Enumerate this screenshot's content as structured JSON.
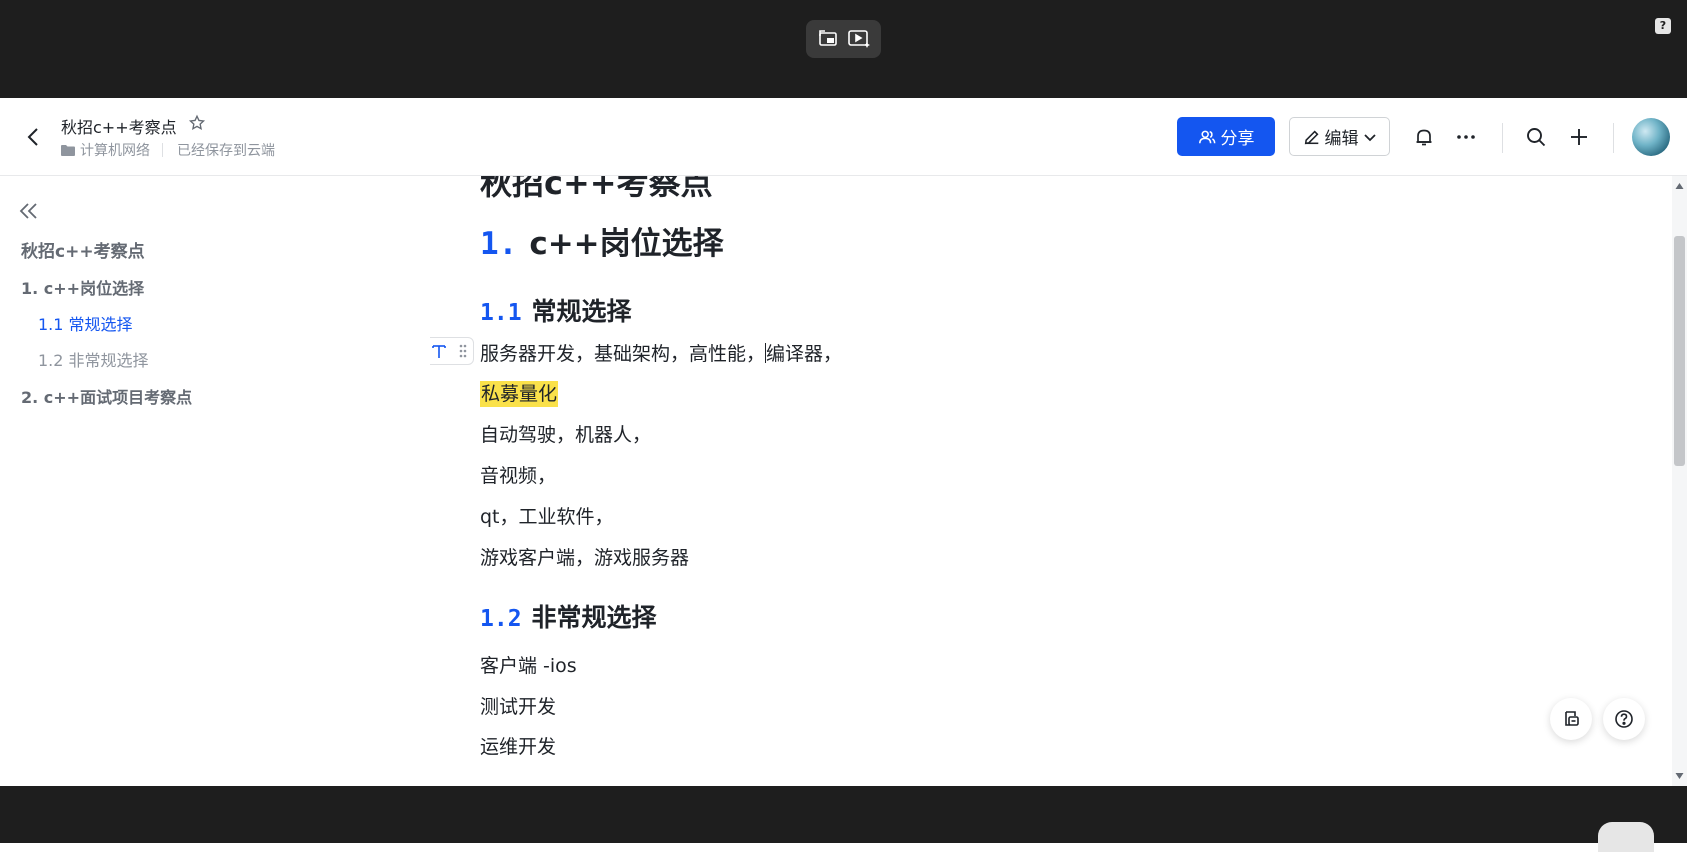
{
  "header": {
    "doc_title": "秋招c++考察点",
    "folder": "计算机网络",
    "save_status": "已经保存到云端",
    "share_label": "分享",
    "edit_label": "编辑"
  },
  "toc": {
    "title": "秋招c++考察点",
    "items": [
      {
        "label": "1. c++岗位选择"
      },
      {
        "label": "1.1 常规选择"
      },
      {
        "label": "1.2 非常规选择"
      },
      {
        "label": "2. c++面试项目考察点"
      }
    ]
  },
  "content": {
    "partial_heading": "秋招c++考察点",
    "h1": {
      "num": "1.",
      "text": "c++岗位选择"
    },
    "s11": {
      "num": "1.1",
      "text": "常规选择"
    },
    "s11_lines": [
      {
        "before": "服务器开发，基础架构，高性能，",
        "after": "编译器，"
      },
      {
        "text": "私募量化"
      },
      {
        "text": "自动驾驶，机器人，"
      },
      {
        "text": "音视频，"
      },
      {
        "text": "qt，工业软件，"
      },
      {
        "text": "游戏客户端，游戏服务器"
      }
    ],
    "s12": {
      "num": "1.2",
      "text": "非常规选择"
    },
    "s12_lines": [
      {
        "text": "客户端 -ios"
      },
      {
        "text": "测试开发"
      },
      {
        "text": "运维开发"
      }
    ]
  },
  "colors": {
    "accent": "#1456f0",
    "highlight": "#fae14a",
    "chrome": "#1e1e1e"
  }
}
